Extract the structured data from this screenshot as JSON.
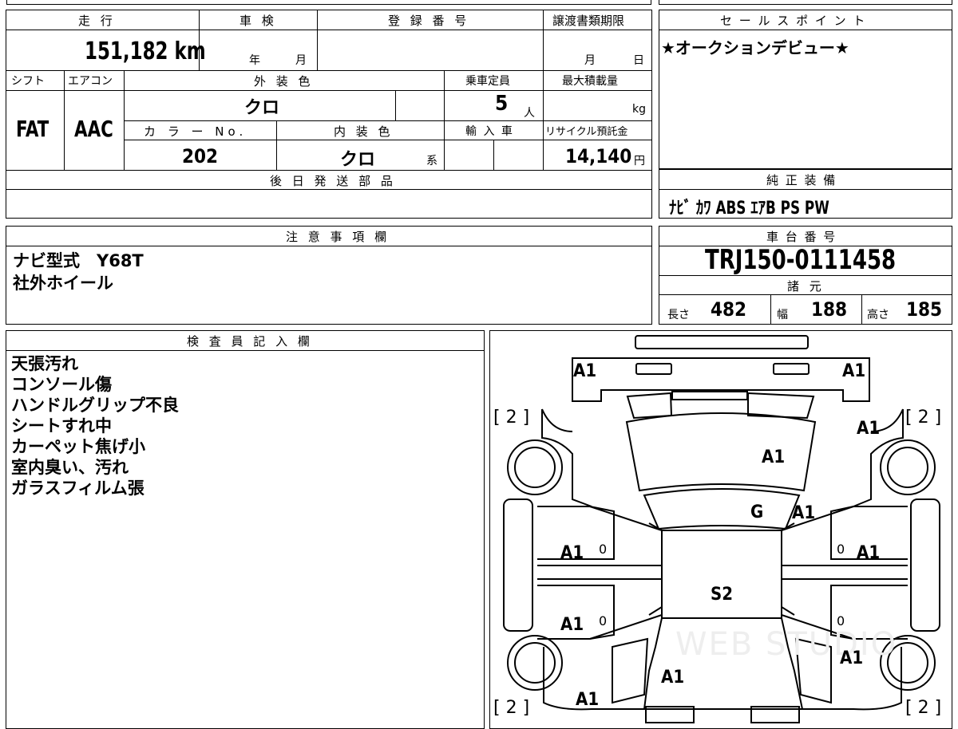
{
  "top_table": {
    "mileage_label": "走 行",
    "mileage_value": "151,182 km",
    "inspection_label": "車 検",
    "inspection_year_unit": "年",
    "inspection_month_unit": "月",
    "registration_label": "登 録 番 号",
    "registration_value": "",
    "transfer_deadline_label": "譲渡書類期限",
    "transfer_month_unit": "月",
    "transfer_day_unit": "日",
    "shift_label": "シフト",
    "shift_value": "FAT",
    "aircon_label": "エアコン",
    "aircon_value": "AAC",
    "exterior_color_label": "外 装 色",
    "exterior_color_value": "クロ",
    "capacity_label": "乗車定員",
    "capacity_value": "5",
    "capacity_unit": "人",
    "max_load_label": "最大積載量",
    "max_load_unit": "kg",
    "color_no_label": "カ ラ ー No.",
    "color_no_value": "202",
    "interior_color_label": "内 装 色",
    "interior_color_value": "クロ",
    "interior_color_suffix": "系",
    "import_label": "輸 入 車",
    "recycle_label": "リサイクル預託金",
    "recycle_value": "14,140",
    "recycle_unit": "円",
    "later_parts_label": "後 日 発 送 部 品",
    "later_parts_value": ""
  },
  "sales_point": {
    "label": "セ ー ル ス ポ イ ン ト",
    "text": "★オークションデビュー★"
  },
  "equipment": {
    "label": "純 正 装 備",
    "text": "ﾅﾋﾞ ｶﾜ ABS ｴｱB PS PW"
  },
  "caution": {
    "label": "注 意 事 項 欄",
    "lines": [
      "ナビ型式　Y68T",
      "社外ホイール"
    ]
  },
  "chassis": {
    "label": "車 台 番 号",
    "number": "TRJ150-0111458",
    "specs_label": "諸 元",
    "length_label": "長さ",
    "length_value": "482",
    "width_label": "幅",
    "width_value": "188",
    "height_label": "高さ",
    "height_value": "185"
  },
  "inspector": {
    "label": "検 査 員 記 入 欄",
    "lines": [
      "天張汚れ",
      "コンソール傷",
      "ハンドルグリップ不良",
      "シートすれ中",
      "カーペット焦げ小",
      "室内臭い、汚れ",
      "ガラスフィルム張"
    ]
  },
  "diagram": {
    "marks": [
      "A1",
      "A1",
      "A1",
      "A1",
      "G",
      "A1",
      "A1",
      "A1",
      "S2",
      "A1",
      "A1",
      "A1",
      "A1"
    ],
    "tires": [
      "[ 2 ]",
      "[ 2 ]",
      "[ 2 ]",
      "[ 2 ]"
    ],
    "small_zero": "0",
    "watermark": "WEB STUDIO"
  }
}
